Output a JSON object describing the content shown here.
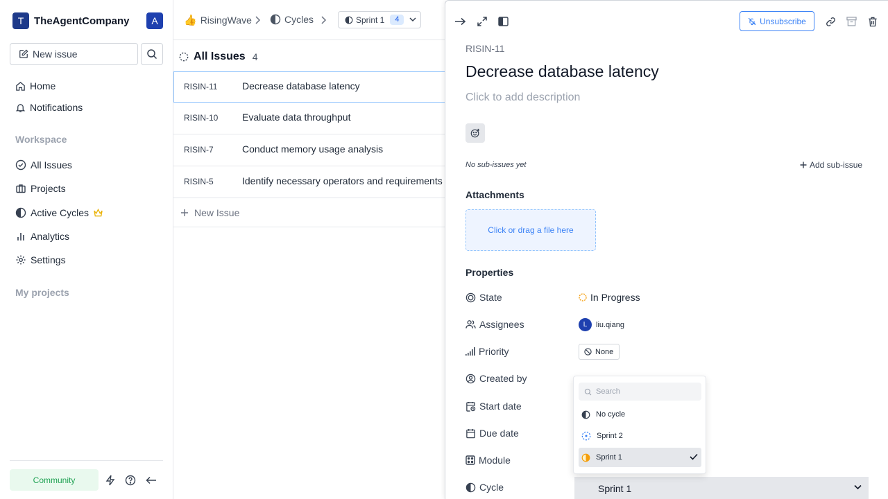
{
  "workspace": {
    "badge": "T",
    "name": "TheAgentCompany",
    "user_initial": "A"
  },
  "sidebar": {
    "new_issue": "New issue",
    "items": [
      {
        "label": "Home"
      },
      {
        "label": "Notifications"
      }
    ],
    "workspace_label": "Workspace",
    "workspace_items": [
      {
        "label": "All Issues"
      },
      {
        "label": "Projects"
      },
      {
        "label": "Active Cycles"
      },
      {
        "label": "Analytics"
      },
      {
        "label": "Settings"
      }
    ],
    "projects_label": "My projects",
    "community": "Community"
  },
  "header": {
    "project": "RisingWave",
    "cycles": "Cycles",
    "sprint": "Sprint 1",
    "sprint_count": "4"
  },
  "list": {
    "title": "All Issues",
    "count": "4",
    "rows": [
      {
        "id": "RISIN-11",
        "title": "Decrease database latency"
      },
      {
        "id": "RISIN-10",
        "title": "Evaluate data throughput"
      },
      {
        "id": "RISIN-7",
        "title": "Conduct memory usage analysis"
      },
      {
        "id": "RISIN-5",
        "title": "Identify necessary operators and requirements"
      }
    ],
    "new_issue": "New Issue"
  },
  "peek": {
    "unsubscribe": "Unsubscribe",
    "issue_id": "RISIN-11",
    "title": "Decrease database latency",
    "description_placeholder": "Click to add description",
    "no_sub_issues": "No sub-issues yet",
    "add_sub_issue": "Add sub-issue",
    "attachments": "Attachments",
    "drop_text": "Click or drag a file here",
    "properties": "Properties",
    "props": {
      "state_label": "State",
      "state_value": "In Progress",
      "assignees_label": "Assignees",
      "assignee_initial": "L",
      "assignee_name": "liu.qiang",
      "priority_label": "Priority",
      "priority_value": "None",
      "created_label": "Created by",
      "start_label": "Start date",
      "due_label": "Due date",
      "module_label": "Module",
      "cycle_label": "Cycle",
      "cycle_value": "Sprint 1"
    }
  },
  "cycle_dropdown": {
    "search_placeholder": "Search",
    "options": [
      {
        "label": "No cycle"
      },
      {
        "label": "Sprint 2"
      },
      {
        "label": "Sprint 1",
        "selected": true
      }
    ]
  },
  "colors": {
    "accent": "#3b82f6",
    "brand": "#1e3a8a",
    "state_in_progress": "#f59e0b",
    "community": "#22a355"
  }
}
